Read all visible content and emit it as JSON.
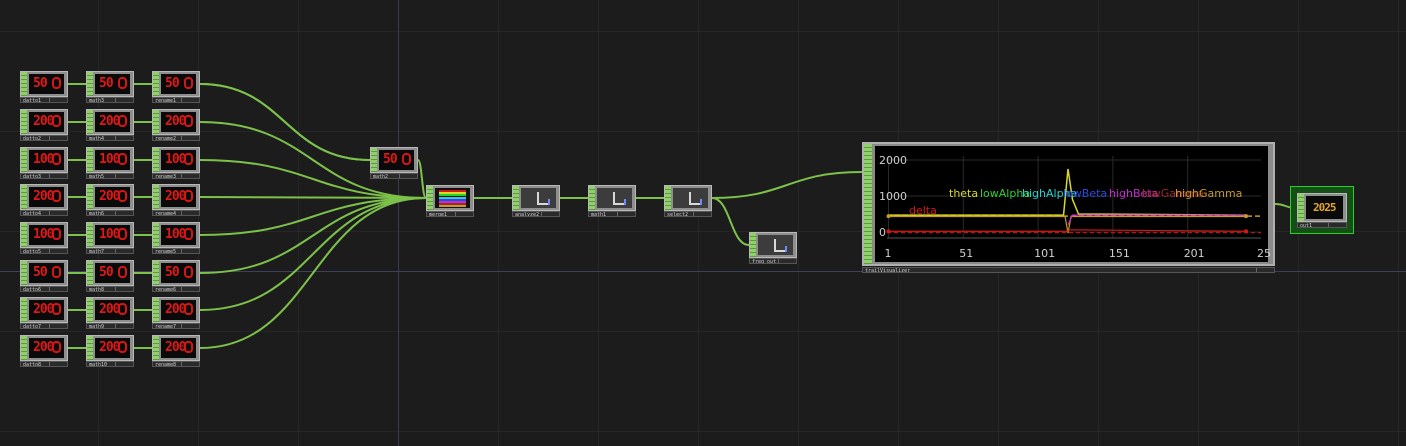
{
  "network": {
    "column1": [
      {
        "label": "datto1",
        "value": "50"
      },
      {
        "label": "datto2",
        "value": "200"
      },
      {
        "label": "datto3",
        "value": "100"
      },
      {
        "label": "datto4",
        "value": "200"
      },
      {
        "label": "datto5",
        "value": "100"
      },
      {
        "label": "datto6",
        "value": "50"
      },
      {
        "label": "datto7",
        "value": "200"
      },
      {
        "label": "datto8",
        "value": "200"
      }
    ],
    "column2": [
      {
        "label": "math3",
        "value": "50"
      },
      {
        "label": "math4",
        "value": "200"
      },
      {
        "label": "math5",
        "value": "100"
      },
      {
        "label": "math6",
        "value": "200"
      },
      {
        "label": "math7",
        "value": "100"
      },
      {
        "label": "math8",
        "value": "50"
      },
      {
        "label": "math9",
        "value": "200"
      },
      {
        "label": "math10",
        "value": "200"
      }
    ],
    "column3": [
      {
        "label": "rename1",
        "value": "50"
      },
      {
        "label": "rename2",
        "value": "200"
      },
      {
        "label": "rename3",
        "value": "100"
      },
      {
        "label": "rename4",
        "value": "200"
      },
      {
        "label": "rename5",
        "value": "100"
      },
      {
        "label": "rename6",
        "value": "50"
      },
      {
        "label": "rename7",
        "value": "200"
      },
      {
        "label": "rename8",
        "value": "200"
      }
    ],
    "math2": {
      "label": "math2",
      "value": "50"
    },
    "merge": {
      "label": "merge1"
    },
    "analyze": {
      "label": "analyze2"
    },
    "math1": {
      "label": "math1"
    },
    "select": {
      "label": "select2"
    },
    "freq": {
      "label": "freq_out"
    },
    "trail": {
      "label": "trailVisualizer",
      "y_ticks": [
        "2000",
        "1000",
        "0"
      ],
      "x_ticks": [
        "1",
        "51",
        "101",
        "151",
        "201",
        "25"
      ],
      "channels": [
        {
          "name": "delta",
          "color": "#d01818"
        },
        {
          "name": "theta",
          "color": "#d8d82a"
        },
        {
          "name": "lowAlpha",
          "color": "#2ecf2e"
        },
        {
          "name": "highAlpha",
          "color": "#2ad0d0"
        },
        {
          "name": "lowBeta",
          "color": "#2a4ae0"
        },
        {
          "name": "highBeta",
          "color": "#c82ad0"
        },
        {
          "name": "lowGamma",
          "color": "#9a2a2a"
        },
        {
          "name": "highGamma",
          "color": "#c89a2a"
        }
      ]
    },
    "out": {
      "label": "out1",
      "value": "2025"
    }
  }
}
